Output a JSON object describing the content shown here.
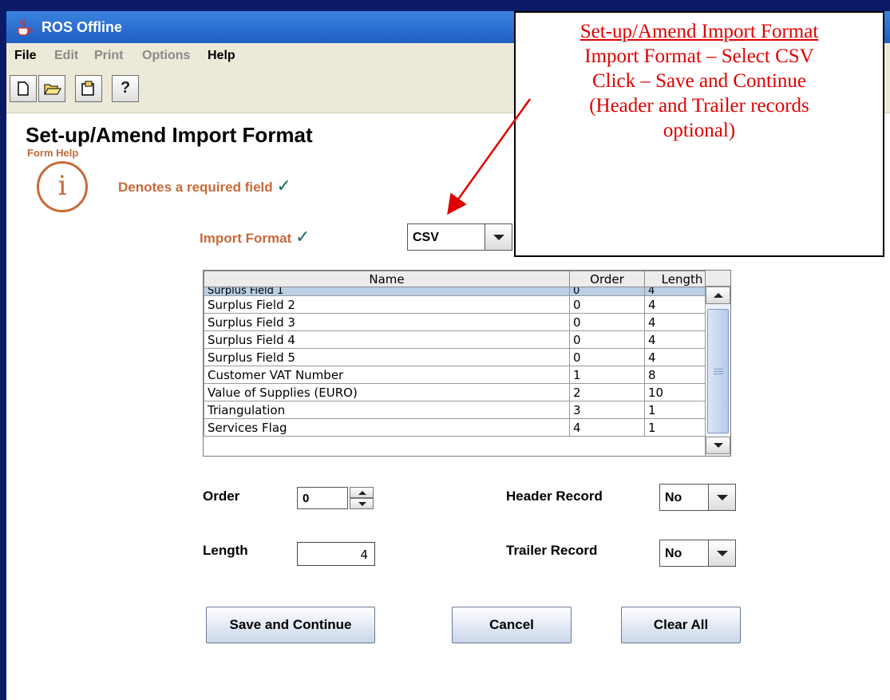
{
  "window": {
    "title": "ROS Offline"
  },
  "menu": [
    {
      "label": "File",
      "enabled": true
    },
    {
      "label": "Edit",
      "enabled": false
    },
    {
      "label": "Print",
      "enabled": false
    },
    {
      "label": "Options",
      "enabled": false
    },
    {
      "label": "Help",
      "enabled": true
    }
  ],
  "toolbar": {
    "icons": [
      "new-document-icon",
      "open-folder-icon",
      "import-icon",
      "help-icon"
    ],
    "help_glyph": "?"
  },
  "page": {
    "title": "Set-up/Amend Import Format",
    "form_help": "Form Help",
    "info_glyph": "i",
    "required_note": "Denotes a required field",
    "check": "✓"
  },
  "import_format": {
    "label": "Import Format",
    "value": "CSV"
  },
  "table": {
    "columns": [
      "Name",
      "Order",
      "Length"
    ],
    "rows": [
      {
        "name": "Surplus Field 1",
        "order": "0",
        "length": "4",
        "selected": true,
        "partial": true
      },
      {
        "name": "Surplus Field 2",
        "order": "0",
        "length": "4"
      },
      {
        "name": "Surplus Field 3",
        "order": "0",
        "length": "4"
      },
      {
        "name": "Surplus Field 4",
        "order": "0",
        "length": "4"
      },
      {
        "name": "Surplus Field 5",
        "order": "0",
        "length": "4"
      },
      {
        "name": "Customer VAT Number",
        "order": "1",
        "length": "8"
      },
      {
        "name": "Value of Supplies (EURO)",
        "order": "2",
        "length": "10"
      },
      {
        "name": "Triangulation",
        "order": "3",
        "length": "1"
      },
      {
        "name": "Services Flag",
        "order": "4",
        "length": "1"
      }
    ]
  },
  "fields": {
    "order_label": "Order",
    "order_value": "0",
    "length_label": "Length",
    "length_value": "4",
    "header_label": "Header Record",
    "header_value": "No",
    "trailer_label": "Trailer Record",
    "trailer_value": "No"
  },
  "buttons": {
    "save": "Save and Continue",
    "cancel": "Cancel",
    "clear": "Clear All"
  },
  "callout": {
    "title": "Set-up/Amend Import Format",
    "lines": [
      "Import Format – Select CSV",
      "Click – Save and Continue",
      "(Header and Trailer records",
      "optional)"
    ],
    "color": "#e00000"
  }
}
